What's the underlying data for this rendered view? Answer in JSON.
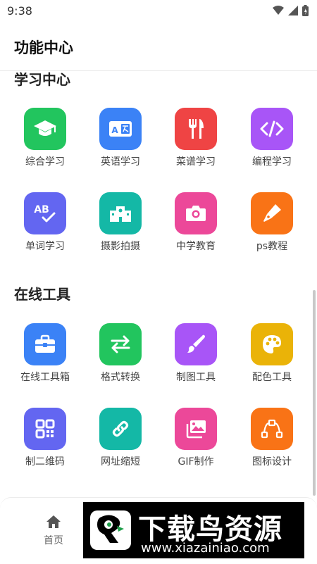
{
  "status": {
    "time": "9:38"
  },
  "appbar": {
    "title": "功能中心"
  },
  "sections": [
    {
      "title": "学习中心",
      "items": [
        {
          "label": "综合学习",
          "icon": "graduation-cap-icon",
          "color": "#22c55e"
        },
        {
          "label": "英语学习",
          "icon": "translate-icon",
          "color": "#3b82f6"
        },
        {
          "label": "菜谱学习",
          "icon": "utensils-icon",
          "color": "#ef4444"
        },
        {
          "label": "编程学习",
          "icon": "code-icon",
          "color": "#a855f7"
        },
        {
          "label": "单词学习",
          "icon": "spellcheck-icon",
          "color": "#6366f1"
        },
        {
          "label": "摄影拍摄",
          "icon": "school-icon",
          "color": "#14b8a6"
        },
        {
          "label": "中学教育",
          "icon": "camera-icon",
          "color": "#ec4899"
        },
        {
          "label": "ps教程",
          "icon": "pen-nib-icon",
          "color": "#f97316"
        }
      ]
    },
    {
      "title": "在线工具",
      "items": [
        {
          "label": "在线工具箱",
          "icon": "toolbox-icon",
          "color": "#3b82f6"
        },
        {
          "label": "格式转换",
          "icon": "swap-arrows-icon",
          "color": "#22c55e"
        },
        {
          "label": "制图工具",
          "icon": "brush-icon",
          "color": "#a855f7"
        },
        {
          "label": "配色工具",
          "icon": "palette-icon",
          "color": "#eab308"
        },
        {
          "label": "制二维码",
          "icon": "qr-code-icon",
          "color": "#6366f1"
        },
        {
          "label": "网址缩短",
          "icon": "link-icon",
          "color": "#14b8a6"
        },
        {
          "label": "GIF制作",
          "icon": "images-icon",
          "color": "#ec4899"
        },
        {
          "label": "图标设计",
          "icon": "bezier-curve-icon",
          "color": "#f97316"
        }
      ]
    }
  ],
  "bottom_nav": {
    "home_label": "首页"
  },
  "watermark": {
    "main_text": "下载鸟资源",
    "url": "www.xiazainiao.com"
  }
}
